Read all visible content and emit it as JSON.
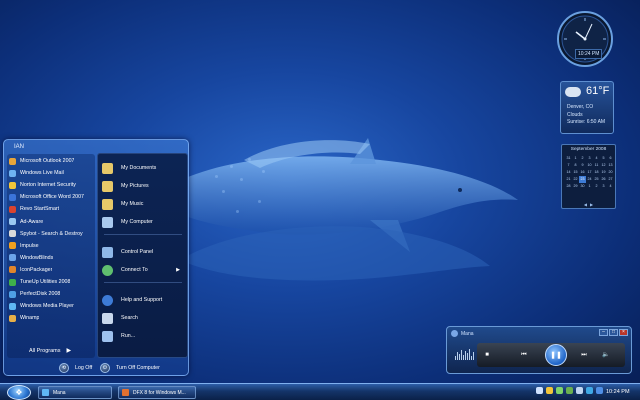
{
  "start_menu": {
    "user_name": "IAN",
    "programs": [
      {
        "label": "Microsoft Outlook 2007",
        "icon": "outlook-icon",
        "color": "#e8a53a"
      },
      {
        "label": "Windows Live Mail",
        "icon": "live-mail-icon",
        "color": "#6fb3f2"
      },
      {
        "label": "Norton Internet Security",
        "icon": "norton-icon",
        "color": "#f2c53a"
      },
      {
        "label": "Microsoft Office Word 2007",
        "icon": "word-icon",
        "color": "#3b74d9"
      },
      {
        "label": "Revo StartSmart",
        "icon": "startsmart-icon",
        "color": "#d9442f"
      },
      {
        "label": "Ad-Aware",
        "icon": "ad-aware-icon",
        "color": "#9ac8f0"
      },
      {
        "label": "Spybot - Search & Destroy",
        "icon": "spybot-icon",
        "color": "#d9d9d9"
      },
      {
        "label": "Impulse",
        "icon": "impulse-icon",
        "color": "#f0a020"
      },
      {
        "label": "WindowBlinds",
        "icon": "windowblinds-icon",
        "color": "#6ba5ea"
      },
      {
        "label": "IconPackager",
        "icon": "iconpackager-icon",
        "color": "#e0852c"
      },
      {
        "label": "TuneUp Utilities 2008",
        "icon": "tuneup-icon",
        "color": "#3fb04a"
      },
      {
        "label": "PerfectDisk 2008",
        "icon": "perfectdisk-icon",
        "color": "#4fa0e6"
      },
      {
        "label": "Windows Media Player",
        "icon": "media-player-icon",
        "color": "#5fb8f5"
      },
      {
        "label": "Winamp",
        "icon": "winamp-icon",
        "color": "#e8b048"
      }
    ],
    "all_programs": "All Programs",
    "places": [
      {
        "label": "My Documents",
        "icon": "documents-icon",
        "color": "#e6c869"
      },
      {
        "label": "My Pictures",
        "icon": "pictures-icon",
        "color": "#e6c869"
      },
      {
        "label": "My Music",
        "icon": "music-icon",
        "color": "#e6c869"
      },
      {
        "label": "My Computer",
        "icon": "computer-icon",
        "color": "#a9c9ee"
      },
      {
        "label": "Control Panel",
        "icon": "control-panel-icon",
        "color": "#8fb8e8"
      },
      {
        "label": "Connect To",
        "icon": "connect-icon",
        "color": "#5fbf6f"
      },
      {
        "label": "Help and Support",
        "icon": "help-icon",
        "color": "#3d7bd6"
      },
      {
        "label": "Search",
        "icon": "search-icon",
        "color": "#c9d8ec"
      },
      {
        "label": "Run...",
        "icon": "run-icon",
        "color": "#9ec1ee"
      }
    ],
    "log_off": "Log Off",
    "turn_off": "Turn Off Computer"
  },
  "gadgets": {
    "clock_time": "10:24 PM",
    "weather": {
      "temp": "61°F",
      "city": "Denver, CO",
      "condition": "Clouds",
      "sunrise": "Sunrise: 6:50 AM"
    },
    "calendar": {
      "title": "September 2008",
      "days": [
        "31",
        "1",
        "2",
        "3",
        "4",
        "5",
        "6",
        "7",
        "8",
        "9",
        "10",
        "11",
        "12",
        "13",
        "14",
        "15",
        "16",
        "17",
        "18",
        "19",
        "20",
        "21",
        "22",
        "23",
        "24",
        "25",
        "26",
        "27",
        "28",
        "29",
        "30",
        "1",
        "2",
        "3",
        "4"
      ],
      "today": "23"
    }
  },
  "media_player": {
    "title": "Mana"
  },
  "taskbar": {
    "tasks": [
      {
        "label": "Mana",
        "icon": "media-player-icon",
        "color": "#5fb8f5"
      },
      {
        "label": "DFX 8 for Windows M...",
        "icon": "dfx-icon",
        "color": "#e07030"
      }
    ],
    "tray_icons": [
      {
        "icon": "arrow-icon",
        "color": "#cfe2ff"
      },
      {
        "icon": "norton-tray-icon",
        "color": "#f2c53a"
      },
      {
        "icon": "network-icon",
        "color": "#7fd46a"
      },
      {
        "icon": "messenger-icon",
        "color": "#6ab04f"
      },
      {
        "icon": "volume-icon",
        "color": "#c0d6f2"
      },
      {
        "icon": "skype-icon",
        "color": "#3fa9e6"
      },
      {
        "icon": "bluetooth-icon",
        "color": "#4f8fe6"
      }
    ],
    "clock": "10:24 PM"
  }
}
